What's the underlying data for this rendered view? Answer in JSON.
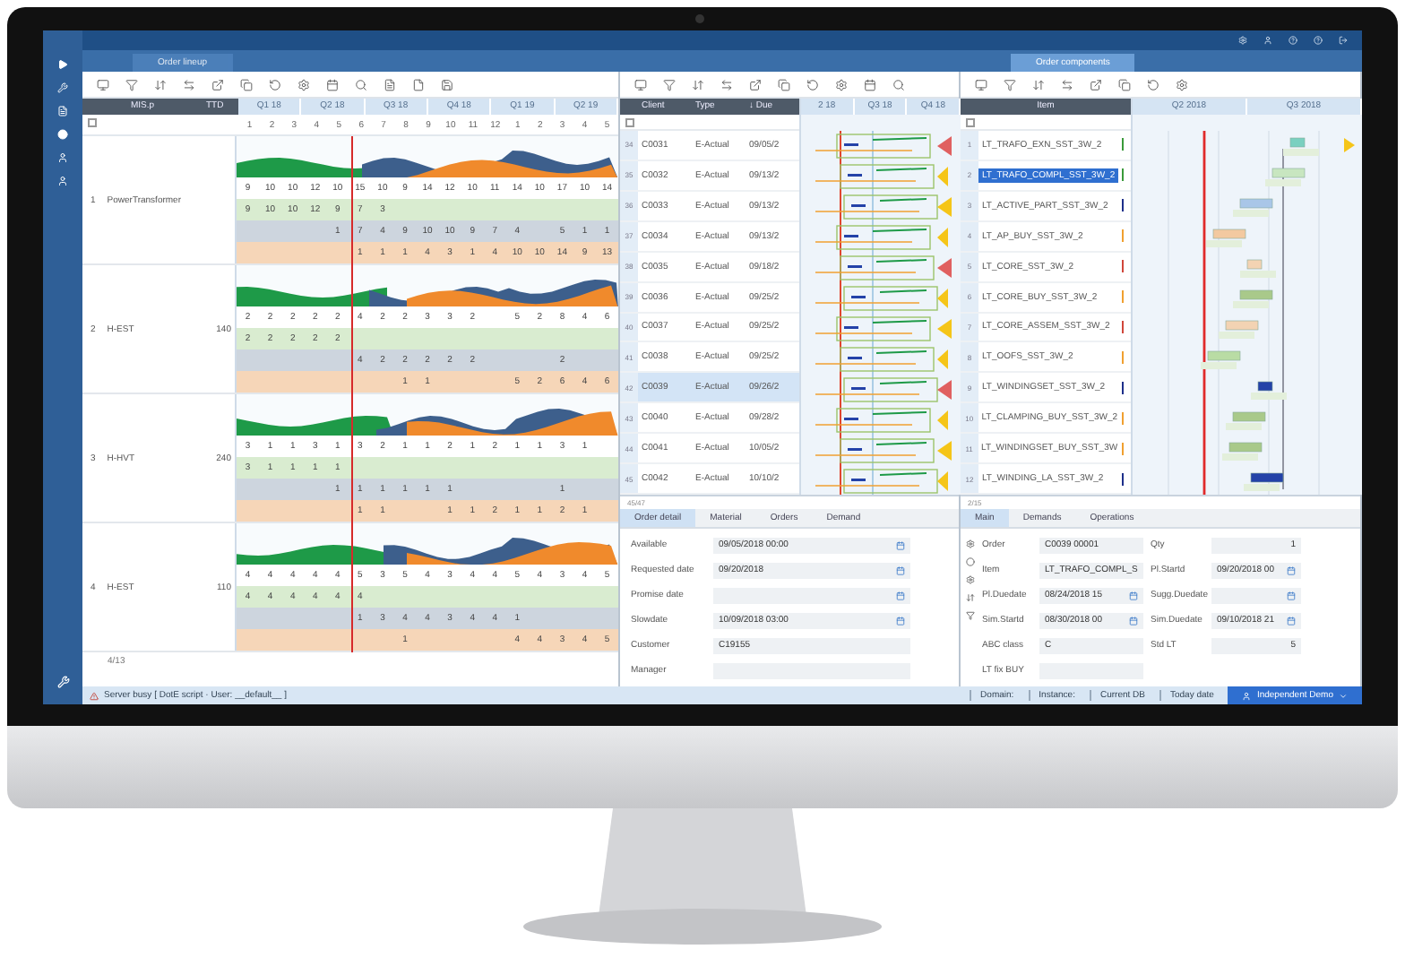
{
  "tabs": [
    {
      "label": "Order lineup",
      "selected": false
    },
    {
      "label": "Order components",
      "selected": true
    }
  ],
  "lineup": {
    "columns": [
      "MIS.p",
      "TTD"
    ],
    "quarters": [
      "Q1 18",
      "Q2 18",
      "Q3 18",
      "Q4 18",
      "Q1 19",
      "Q2 19"
    ],
    "weeks": [
      "1",
      "2",
      "3",
      "4",
      "5",
      "6",
      "7",
      "8",
      "9",
      "10",
      "11",
      "12",
      "1",
      "2",
      "3",
      "4",
      "5"
    ],
    "groups": [
      {
        "num": "1",
        "name": "PowerTransformer",
        "bands": [
          {
            "kind": "total",
            "cells": [
              "9",
              "10",
              "10",
              "12",
              "10",
              "15",
              "10",
              "9",
              "14",
              "12",
              "10",
              "11",
              "14",
              "10",
              "17",
              "10",
              "14"
            ]
          },
          {
            "kind": "plan",
            "cells": [
              "9",
              "10",
              "10",
              "12",
              "9",
              "7",
              "3",
              null,
              null,
              null,
              null,
              null,
              null,
              null,
              null,
              null,
              null
            ]
          },
          {
            "kind": "stock",
            "cells": [
              null,
              null,
              null,
              null,
              "1",
              "7",
              "4",
              "9",
              "10",
              "10",
              "9",
              "7",
              "4",
              null,
              "5",
              "1",
              "1"
            ]
          },
          {
            "kind": "demand",
            "cells": [
              null,
              null,
              null,
              null,
              null,
              "1",
              "1",
              "1",
              "4",
              "3",
              "1",
              "4",
              "10",
              "10",
              "14",
              "9",
              "13"
            ]
          }
        ]
      },
      {
        "num": "2",
        "name": "H-EST",
        "qty": "140",
        "bands": [
          {
            "kind": "total",
            "cells": [
              "2",
              "2",
              "2",
              "2",
              "2",
              "4",
              "2",
              "2",
              "3",
              "3",
              "2",
              null,
              "5",
              "2",
              "8",
              "4",
              "6"
            ]
          },
          {
            "kind": "plan",
            "cells": [
              "2",
              "2",
              "2",
              "2",
              "2",
              null,
              null,
              null,
              null,
              null,
              null,
              null,
              null,
              null,
              null,
              null,
              null
            ]
          },
          {
            "kind": "stock",
            "cells": [
              null,
              null,
              null,
              null,
              null,
              "4",
              "2",
              "2",
              "2",
              "2",
              "2",
              null,
              null,
              null,
              "2",
              null,
              null
            ]
          },
          {
            "kind": "demand",
            "cells": [
              null,
              null,
              null,
              null,
              null,
              null,
              null,
              "1",
              "1",
              null,
              null,
              null,
              "5",
              "2",
              "6",
              "4",
              "6"
            ]
          }
        ]
      },
      {
        "num": "3",
        "name": "H-HVT",
        "qty": "240",
        "bands": [
          {
            "kind": "total",
            "cells": [
              "3",
              "1",
              "1",
              "3",
              "1",
              "3",
              "2",
              "1",
              "1",
              "2",
              "1",
              "2",
              "1",
              "1",
              "3",
              "1",
              null
            ]
          },
          {
            "kind": "plan",
            "cells": [
              "3",
              "1",
              "1",
              "1",
              "1",
              null,
              null,
              null,
              null,
              null,
              null,
              null,
              null,
              null,
              null,
              null,
              null
            ]
          },
          {
            "kind": "stock",
            "cells": [
              null,
              null,
              null,
              null,
              "1",
              "1",
              "1",
              "1",
              "1",
              "1",
              null,
              null,
              null,
              null,
              "1",
              null,
              null
            ]
          },
          {
            "kind": "demand",
            "cells": [
              null,
              null,
              null,
              null,
              null,
              "1",
              "1",
              null,
              null,
              "1",
              "1",
              "2",
              "1",
              "1",
              "2",
              "1",
              null
            ]
          }
        ]
      },
      {
        "num": "4",
        "name": "H-EST",
        "qty": "110",
        "bands": [
          {
            "kind": "total",
            "cells": [
              "4",
              "4",
              "4",
              "4",
              "4",
              "5",
              "3",
              "5",
              "4",
              "3",
              "4",
              "4",
              "5",
              "4",
              "3",
              "4",
              "5"
            ]
          },
          {
            "kind": "plan",
            "cells": [
              "4",
              "4",
              "4",
              "4",
              "4",
              "4",
              null,
              null,
              null,
              null,
              null,
              null,
              null,
              null,
              null,
              null,
              null
            ]
          },
          {
            "kind": "stock",
            "cells": [
              null,
              null,
              null,
              null,
              null,
              "1",
              "3",
              "4",
              "4",
              "3",
              "4",
              "4",
              "1",
              null,
              null,
              null,
              null
            ]
          },
          {
            "kind": "demand",
            "cells": [
              null,
              null,
              null,
              null,
              null,
              null,
              null,
              "1",
              null,
              null,
              null,
              null,
              "4",
              "4",
              "3",
              "4",
              "5"
            ]
          }
        ]
      }
    ],
    "footer": "4/13",
    "select_all": {
      "checked": false
    }
  },
  "orders": {
    "select_all": {
      "checked": false
    },
    "columns": [
      "Client",
      "Type",
      "↓ Due"
    ],
    "quarters": [
      "2 18",
      "Q3 18",
      "Q4 18"
    ],
    "rows": [
      {
        "num": "34",
        "client": "C0031",
        "type": "E-Actual",
        "date": "09/05/2",
        "selected": false
      },
      {
        "num": "35",
        "client": "C0032",
        "type": "E-Actual",
        "date": "09/13/2",
        "selected": false
      },
      {
        "num": "36",
        "client": "C0033",
        "type": "E-Actual",
        "date": "09/13/2",
        "selected": false
      },
      {
        "num": "37",
        "client": "C0034",
        "type": "E-Actual",
        "date": "09/13/2",
        "selected": false
      },
      {
        "num": "38",
        "client": "C0035",
        "type": "E-Actual",
        "date": "09/18/2",
        "selected": false
      },
      {
        "num": "39",
        "client": "C0036",
        "type": "E-Actual",
        "date": "09/25/2",
        "selected": false
      },
      {
        "num": "40",
        "client": "C0037",
        "type": "E-Actual",
        "date": "09/25/2",
        "selected": false
      },
      {
        "num": "41",
        "client": "C0038",
        "type": "E-Actual",
        "date": "09/25/2",
        "selected": false
      },
      {
        "num": "42",
        "client": "C0039",
        "type": "E-Actual",
        "date": "09/26/2",
        "selected": true
      },
      {
        "num": "43",
        "client": "C0040",
        "type": "E-Actual",
        "date": "09/28/2",
        "selected": false
      },
      {
        "num": "44",
        "client": "C0041",
        "type": "E-Actual",
        "date": "10/05/2",
        "selected": false
      },
      {
        "num": "45",
        "client": "C0042",
        "type": "E-Actual",
        "date": "10/10/2",
        "selected": false
      }
    ]
  },
  "order_detail": {
    "count": "45/47",
    "tabs": [
      {
        "label": "Order detail",
        "selected": true
      },
      {
        "label": "Material",
        "selected": false
      },
      {
        "label": "Orders",
        "selected": false
      },
      {
        "label": "Demand",
        "selected": false
      }
    ],
    "fields": [
      {
        "label": "Available",
        "value": "09/05/2018 00:00",
        "kind": "date"
      },
      {
        "label": "Requested date",
        "value": "09/20/2018",
        "kind": "date"
      },
      {
        "label": "Promise date",
        "kind": "date"
      },
      {
        "label": "Slowdate",
        "value": "10/09/2018 03:00",
        "kind": "date"
      },
      {
        "label": "Customer",
        "value": "C19155",
        "kind": "text"
      },
      {
        "label": "Manager",
        "kind": "text"
      }
    ]
  },
  "items": {
    "select_all": {
      "checked": false
    },
    "column": "Item",
    "quarters": [
      "Q2 2018",
      "Q3 2018"
    ],
    "rows": [
      {
        "num": "1",
        "name": "LT_TRAFO_EXN_SST_3W_2",
        "selected": false,
        "color": "#3a9a3a"
      },
      {
        "num": "2",
        "name": "LT_TRAFO_COMPL_SST_3W_2",
        "selected": true,
        "color": "#3a9a3a"
      },
      {
        "num": "3",
        "name": "LT_ACTIVE_PART_SST_3W_2",
        "selected": false,
        "color": "#1d2f8a"
      },
      {
        "num": "4",
        "name": "LT_AP_BUY_SST_3W_2",
        "selected": false,
        "color": "#f0a030"
      },
      {
        "num": "5",
        "name": "LT_CORE_SST_3W_2",
        "selected": false,
        "color": "#d0463a"
      },
      {
        "num": "6",
        "name": "LT_CORE_BUY_SST_3W_2",
        "selected": false,
        "color": "#f0a030"
      },
      {
        "num": "7",
        "name": "LT_CORE_ASSEM_SST_3W_2",
        "selected": false,
        "color": "#d0463a"
      },
      {
        "num": "8",
        "name": "LT_OOFS_SST_3W_2",
        "selected": false,
        "color": "#f0a030"
      },
      {
        "num": "9",
        "name": "LT_WINDINGSET_SST_3W_2",
        "selected": false,
        "color": "#1d2f8a"
      },
      {
        "num": "10",
        "name": "LT_CLAMPING_BUY_SST_3W_2",
        "selected": false,
        "color": "#f0a030"
      },
      {
        "num": "11",
        "name": "LT_WINDINGSET_BUY_SST_3W",
        "selected": false,
        "color": "#f0a030"
      },
      {
        "num": "12",
        "name": "LT_WINDING_LA_SST_3W_2",
        "selected": false,
        "color": "#1d2f8a"
      }
    ]
  },
  "item_detail": {
    "count": "2/15",
    "tabs": [
      {
        "label": "Main",
        "selected": true
      },
      {
        "label": "Demands",
        "selected": false
      },
      {
        "label": "Operations",
        "selected": false
      }
    ],
    "left_fields": [
      {
        "label": "Order",
        "value": "C0039 00001",
        "kind": "text"
      },
      {
        "label": "Item",
        "value": "LT_TRAFO_COMPL_S",
        "kind": "text"
      },
      {
        "label": "Pl.Duedate",
        "value": "08/24/2018 15",
        "kind": "date"
      },
      {
        "label": "Sim.Startd",
        "value": "08/30/2018 00",
        "kind": "date"
      },
      {
        "label": "ABC class",
        "value": "C",
        "kind": "text"
      },
      {
        "label": "LT fix BUY",
        "kind": "text"
      }
    ],
    "right_fields": [
      {
        "label": "Qty",
        "value": "1",
        "kind": "number"
      },
      {
        "label": "Pl.Startd",
        "value": "09/20/2018 00",
        "kind": "date"
      },
      {
        "label": "Sugg.Duedate",
        "kind": "date"
      },
      {
        "label": "Sim.Duedate",
        "value": "09/10/2018 21",
        "kind": "date"
      },
      {
        "label": "Std LT",
        "value": "5",
        "kind": "number"
      }
    ]
  },
  "status_bar": {
    "message": "Server busy [ DotE script · User: __default__ ]",
    "items": [
      "Domain:",
      "Instance:",
      "Current DB",
      "Today date"
    ],
    "user": "Independent Demo"
  }
}
